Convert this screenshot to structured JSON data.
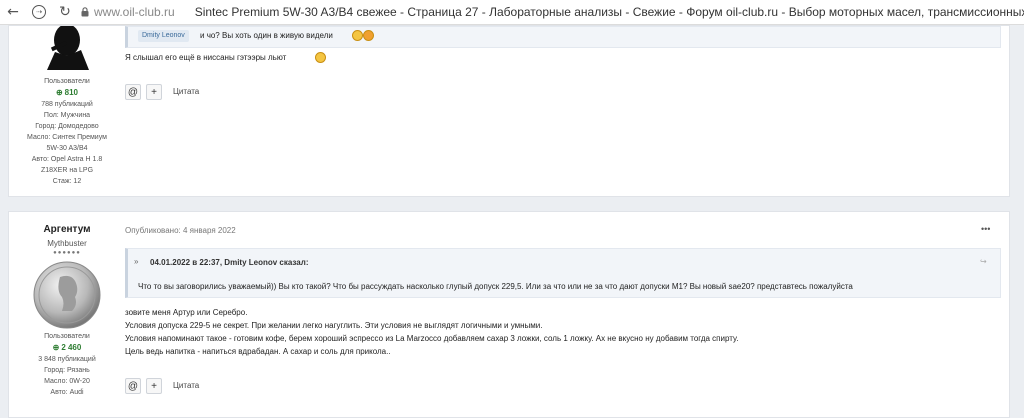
{
  "browser": {
    "back_icon": "←",
    "forward_icon": "⟳",
    "reload_icon": "↻",
    "url": "www.oil-club.ru",
    "page_title": "Sintec Premium 5W-30 A3/B4 свежее - Страница 27 - Лабораторные анализы - Свежие - Форум oil-club.ru - Выбор моторных масел, трансмиссионных жидкостей, антифризов"
  },
  "post1": {
    "role": "Пользователи",
    "reputation": "810",
    "publications": "788 публикаций",
    "gender": "Пол: Мужчина",
    "city": "Город: Домодедово",
    "oil_1": "Масло: Синтек Премиум",
    "oil_2": "5W-30 A3/B4",
    "car_1": "Авто: Opel Astra H 1.8",
    "car_2": "Z18XER на LPG",
    "experience": "Стаж: 12",
    "quote_mention": "Dmity Leonov",
    "quote_text": "и чо? Вы хоть один в живую видели",
    "body": "Я слышал его ещё в ниссаны гэтээры льют",
    "at_label": "@",
    "plus_label": "+",
    "quote_btn": "Цитата"
  },
  "post2": {
    "name": "Аргентум",
    "rank": "Mythbuster",
    "rank_pips": "●●●●●●",
    "role": "Пользователи",
    "reputation": "2 460",
    "publications": "3 848 публикаций",
    "city": "Город: Рязань",
    "oil": "Масло: 0W-20",
    "car": "Авто: Audi",
    "published": "Опубликовано: 4 января 2022",
    "menu": "•••",
    "quote_header": "04.01.2022 в 22:37, Dmity Leonov сказал:",
    "quote_text": "Что то вы заговорились уважаемый)) Вы кто такой? Что бы рассуждать насколько глупый допуск 229,5. Или за что или не за что дают допуски М1? Вы новый sae20? представтесь пожалуйста",
    "lines": [
      "зовите меня Артур или Серебро.",
      "Условия допуска 229-5 не секрет. При желании легко нагуглить. Эти условия не выглядят логичными и умными.",
      "Условия напоминают такое - готовим кофе, берем хороший эспрессо из La Marzocco добавляем сахар 3 ложки, соль 1 ложку. Ах не вкусно ну добавим тогда спирту.",
      "Цель ведь напитка - напиться вдрабадан. А сахар и соль для прикола.."
    ],
    "at_label": "@",
    "plus_label": "+",
    "quote_btn": "Цитата"
  }
}
